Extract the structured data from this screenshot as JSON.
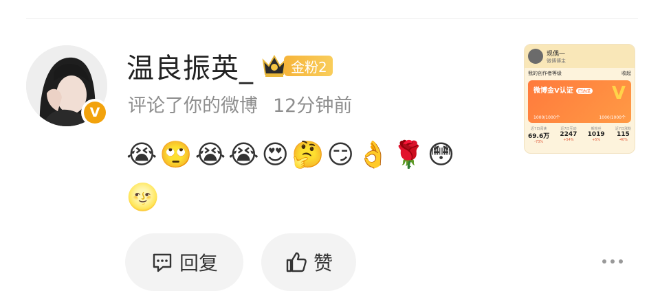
{
  "comment": {
    "username": "温良振英_",
    "fan_badge": "金粉2",
    "action": "评论了你的微博",
    "time": "12分钟前",
    "emoji_lines": [
      [
        "😭",
        "🙄",
        "😭",
        "😭",
        "😍",
        "🤔",
        "😏",
        "👌",
        "🌹",
        "😳"
      ],
      [
        "🌝"
      ]
    ]
  },
  "actions": {
    "reply_label": "回复",
    "like_label": "赞"
  },
  "thumbnail": {
    "username": "现偶一",
    "subtitle": "微博博主",
    "section_left": "我的创作者等级",
    "section_right": "收起",
    "card_title": "微博金V认证",
    "card_tag": "已达成",
    "card_v": "V",
    "card_stat_left": "1000/1000个",
    "card_stat_right": "1000/1000个",
    "stats": [
      {
        "label": "近7日阅读",
        "value": "69.6万",
        "delta": "-73%"
      },
      {
        "label": "近7日互动",
        "value": "2247",
        "delta": "+54%"
      },
      {
        "label": "新粉丝",
        "value": "1019",
        "delta": "+5%"
      },
      {
        "label": "近7日涨粉",
        "value": "115",
        "delta": "-40%"
      }
    ]
  },
  "colors": {
    "verified_badge": "#f2a20c",
    "fan_badge": "#f6b43a",
    "button_bg": "#f3f3f3",
    "meta_text": "#8e8e8e"
  }
}
